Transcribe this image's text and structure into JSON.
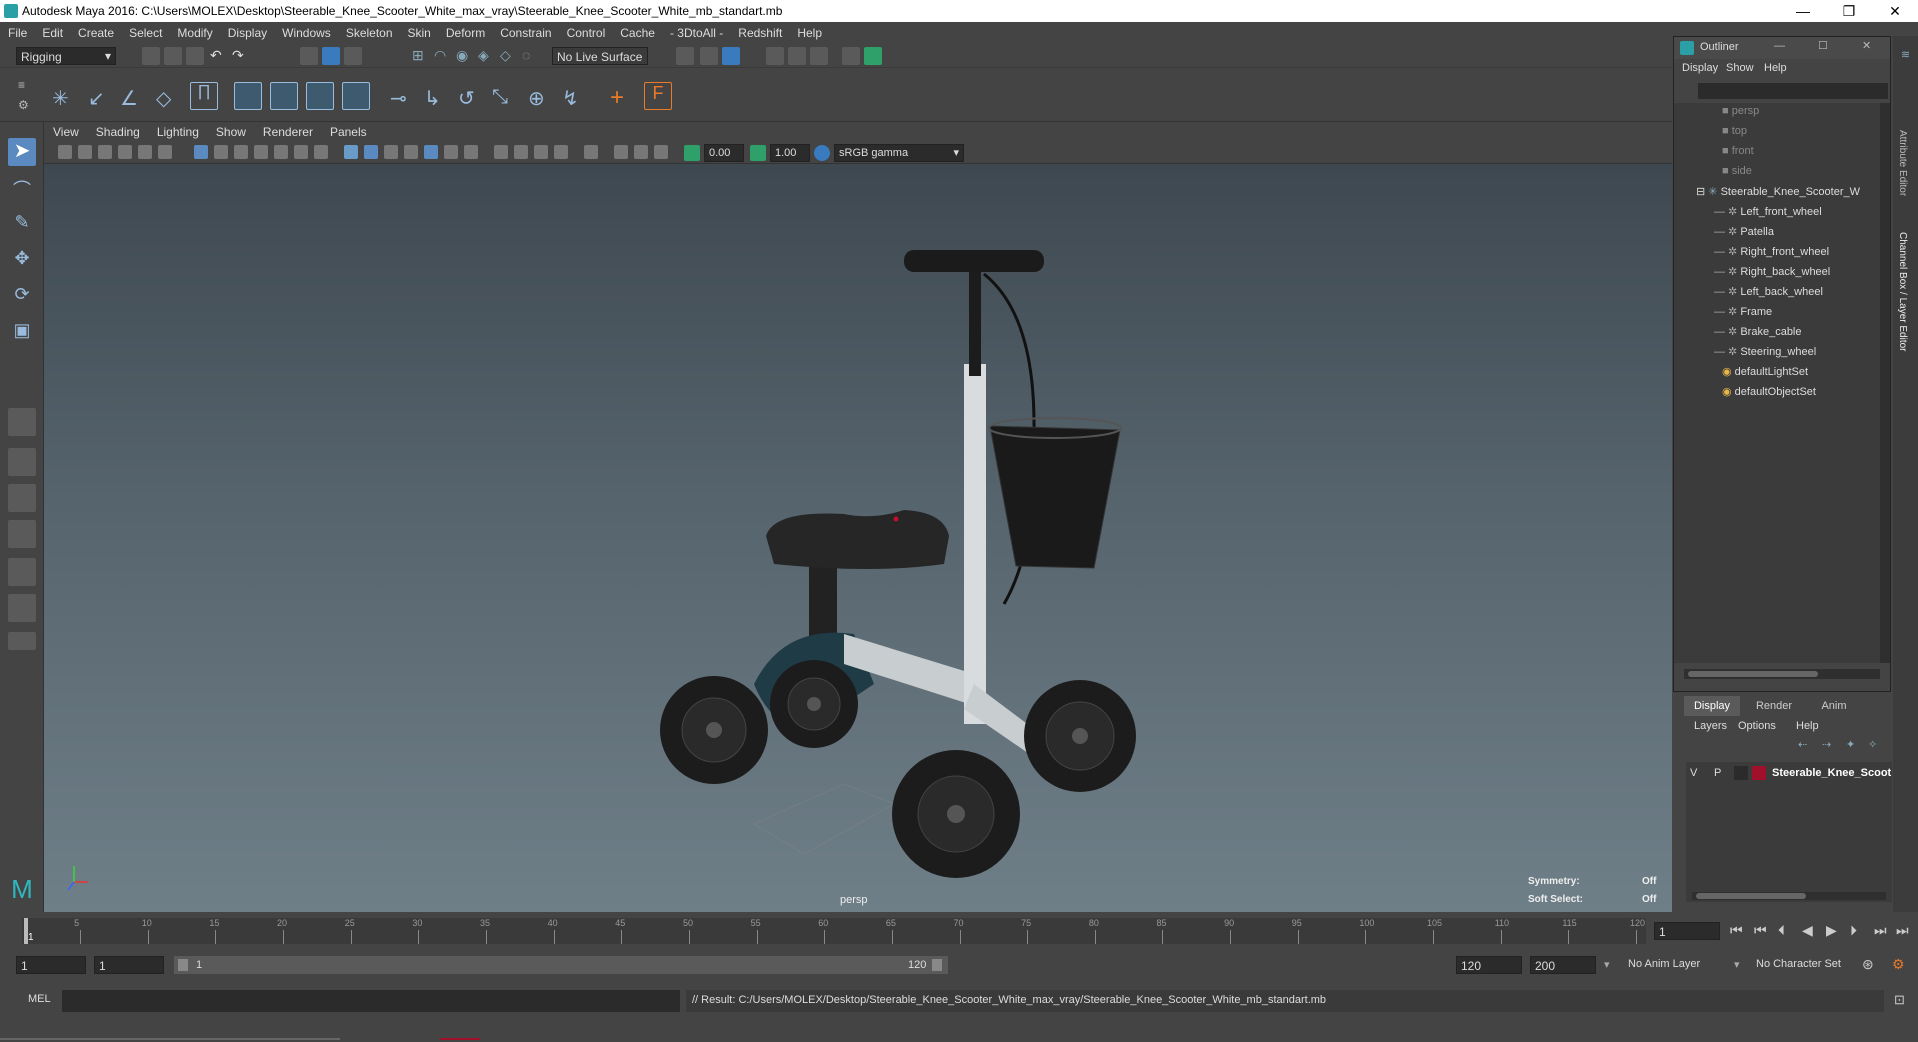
{
  "window": {
    "title": "Autodesk Maya 2016: C:\\Users\\MOLEX\\Desktop\\Steerable_Knee_Scooter_White_max_vray\\Steerable_Knee_Scooter_White_mb_standart.mb",
    "minimize": "—",
    "restore": "❐",
    "close": "✕"
  },
  "menubar": [
    "File",
    "Edit",
    "Create",
    "Select",
    "Modify",
    "Display",
    "Windows",
    "Skeleton",
    "Skin",
    "Deform",
    "Constrain",
    "Control",
    "Cache",
    "- 3DtoAll -",
    "Redshift",
    "Help"
  ],
  "statusline": {
    "menuset": "Rigging",
    "live_surface": "No Live Surface"
  },
  "panel": {
    "menus": [
      "View",
      "Shading",
      "Lighting",
      "Show",
      "Renderer",
      "Panels"
    ],
    "exposure": "0.00",
    "gamma": "1.00",
    "colorspace": "sRGB gamma"
  },
  "viewport": {
    "camera": "persp",
    "symmetry_label": "Symmetry:",
    "symmetry_value": "Off",
    "softselect_label": "Soft Select:",
    "softselect_value": "Off"
  },
  "outliner": {
    "title": "Outliner",
    "menus": [
      "Display",
      "Show",
      "Help"
    ],
    "cameras": [
      "persp",
      "top",
      "front",
      "side"
    ],
    "root": "Steerable_Knee_Scooter_W",
    "children": [
      "Left_front_wheel",
      "Patella",
      "Right_front_wheel",
      "Right_back_wheel",
      "Left_back_wheel",
      "Frame",
      "Brake_cable",
      "Steering_wheel"
    ],
    "sets": [
      "defaultLightSet",
      "defaultObjectSet"
    ]
  },
  "layers": {
    "tabs": [
      "Display",
      "Render",
      "Anim"
    ],
    "menus": [
      "Layers",
      "Options",
      "Help"
    ],
    "row": {
      "v": "V",
      "p": "P",
      "name": "Steerable_Knee_Scoot",
      "color": "#a0102a"
    }
  },
  "sidetabs": [
    "Attribute Editor",
    "Channel Box / Layer Editor"
  ],
  "timeline": {
    "ticks": [
      "5",
      "10",
      "15",
      "20",
      "25",
      "30",
      "35",
      "40",
      "45",
      "50",
      "55",
      "60",
      "65",
      "70",
      "75",
      "80",
      "85",
      "90",
      "95",
      "100",
      "105",
      "110",
      "115",
      "120"
    ],
    "start_label": "1",
    "current_frame": "1"
  },
  "range": {
    "start": "1",
    "playback_start": "1",
    "slider_start": "1",
    "slider_end": "120",
    "playback_end": "120",
    "end": "200",
    "anim_layer": "No Anim Layer",
    "character_set": "No Character Set"
  },
  "cmdline": {
    "mode": "MEL",
    "result": "// Result: C:/Users/MOLEX/Desktop/Steerable_Knee_Scooter_White_max_vray/Steerable_Knee_Scooter_White_mb_standart.mb"
  }
}
